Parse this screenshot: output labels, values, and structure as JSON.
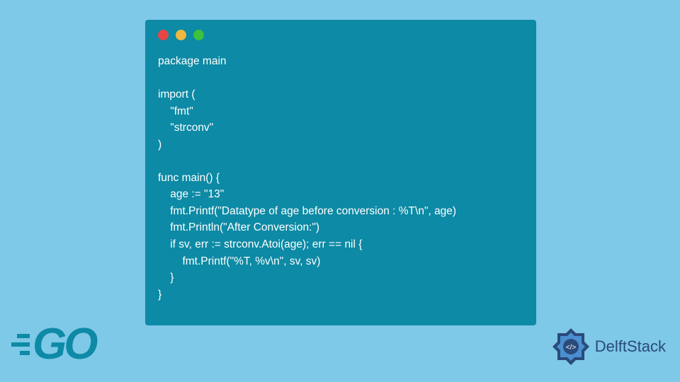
{
  "code": {
    "line1": "package main",
    "line2": "",
    "line3": "import (",
    "line4": "    \"fmt\"",
    "line5": "    \"strconv\"",
    "line6": ")",
    "line7": "",
    "line8": "func main() {",
    "line9": "    age := \"13\"",
    "line10": "    fmt.Printf(\"Datatype of age before conversion : %T\\n\", age)",
    "line11": "    fmt.Println(\"After Conversion:\")",
    "line12": "    if sv, err := strconv.Atoi(age); err == nil {",
    "line13": "        fmt.Printf(\"%T, %v\\n\", sv, sv)",
    "line14": "    }",
    "line15": "}"
  },
  "logos": {
    "go": "GO",
    "delftstack": "DelftStack"
  }
}
